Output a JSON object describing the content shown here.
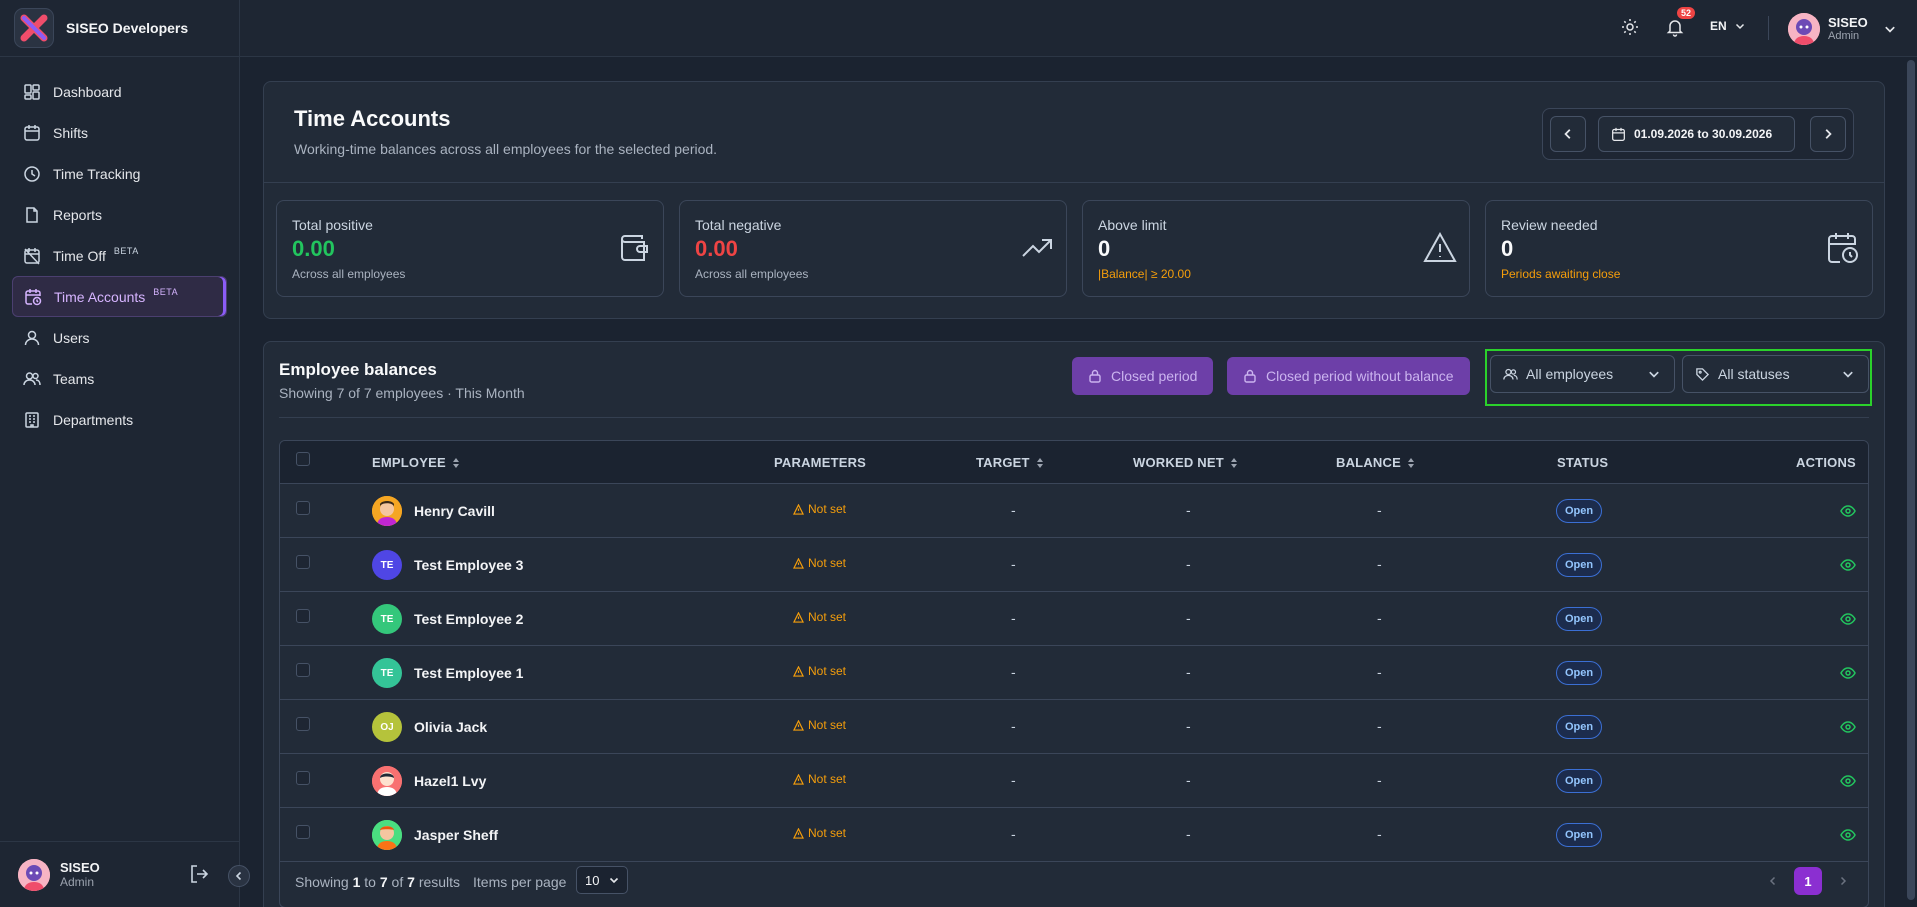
{
  "brand": {
    "name": "SISEO Developers"
  },
  "sidebar": {
    "items": [
      {
        "label": "Dashboard",
        "icon": "dashboard-icon"
      },
      {
        "label": "Shifts",
        "icon": "calendar-icon"
      },
      {
        "label": "Time Tracking",
        "icon": "clock-icon"
      },
      {
        "label": "Reports",
        "icon": "report-icon"
      },
      {
        "label": "Time Off",
        "badge": "BETA",
        "icon": "calendar-off-icon"
      },
      {
        "label": "Time Accounts",
        "badge": "BETA",
        "icon": "calendar-clock-icon",
        "active": true
      },
      {
        "label": "Users",
        "icon": "user-icon"
      },
      {
        "label": "Teams",
        "icon": "users-icon"
      },
      {
        "label": "Departments",
        "icon": "building-icon"
      }
    ],
    "user": {
      "name": "SISEO",
      "role": "Admin"
    }
  },
  "topbar": {
    "notifications": "52",
    "language": "EN",
    "user": {
      "name": "SISEO",
      "role": "Admin"
    }
  },
  "header": {
    "title": "Time Accounts",
    "subtitle": "Working-time balances across all employees for the selected period.",
    "date_range": "01.09.2026 to 30.09.2026"
  },
  "stats": [
    {
      "label": "Total positive",
      "value": "0.00",
      "sub": "Across all employees",
      "icon": "wallet-icon"
    },
    {
      "label": "Total negative",
      "value": "0.00",
      "sub": "Across all employees",
      "icon": "trending-icon"
    },
    {
      "label": "Above limit",
      "value": "0",
      "sub": "|Balance| ≥ 20.00",
      "icon": "warning-icon"
    },
    {
      "label": "Review needed",
      "value": "0",
      "sub": "Periods awaiting close",
      "icon": "calendar-clock-icon"
    }
  ],
  "balances": {
    "title": "Employee balances",
    "subtitle": "Showing 7 of 7 employees · This Month",
    "closed_period": "Closed period",
    "closed_without_balance": "Closed period without balance",
    "employee_filter": "All employees",
    "status_filter": "All statuses"
  },
  "table": {
    "columns": {
      "employee": "EMPLOYEE",
      "parameters": "PARAMETERS",
      "target": "TARGET",
      "worked_net": "WORKED NET",
      "balance": "BALANCE",
      "status": "STATUS",
      "actions": "ACTIONS"
    },
    "rows": [
      {
        "name": "Henry Cavill",
        "initials": "",
        "avatar_color": "#f59e0b",
        "parameters": "Not set",
        "target": "-",
        "worked": "-",
        "balance": "-",
        "status": "Open"
      },
      {
        "name": "Test Employee 3",
        "initials": "TE",
        "avatar_color": "#4f46e5",
        "parameters": "Not set",
        "target": "-",
        "worked": "-",
        "balance": "-",
        "status": "Open"
      },
      {
        "name": "Test Employee 2",
        "initials": "TE",
        "avatar_color": "#34c77b",
        "parameters": "Not set",
        "target": "-",
        "worked": "-",
        "balance": "-",
        "status": "Open"
      },
      {
        "name": "Test Employee 1",
        "initials": "TE",
        "avatar_color": "#34c497",
        "parameters": "Not set",
        "target": "-",
        "worked": "-",
        "balance": "-",
        "status": "Open"
      },
      {
        "name": "Olivia Jack",
        "initials": "OJ",
        "avatar_color": "#b5c33b",
        "parameters": "Not set",
        "target": "-",
        "worked": "-",
        "balance": "-",
        "status": "Open"
      },
      {
        "name": "Hazel1 Lvy",
        "initials": "",
        "avatar_color": "#f87171",
        "parameters": "Not set",
        "target": "-",
        "worked": "-",
        "balance": "-",
        "status": "Open"
      },
      {
        "name": "Jasper Sheff",
        "initials": "",
        "avatar_color": "#4ade80",
        "parameters": "Not set",
        "target": "-",
        "worked": "-",
        "balance": "-",
        "status": "Open"
      }
    ]
  },
  "footer": {
    "showing_prefix": "Showing",
    "from": "1",
    "to_word": "to",
    "to": "7",
    "of_word": "of",
    "total": "7",
    "results_word": "results",
    "items_per_page_label": "Items per page",
    "items_per_page": "10",
    "current_page": "1"
  },
  "colors": {
    "accent": "#8b5cf6",
    "positive": "#22c55e",
    "negative": "#ef4444",
    "warning": "#f59e0b"
  }
}
